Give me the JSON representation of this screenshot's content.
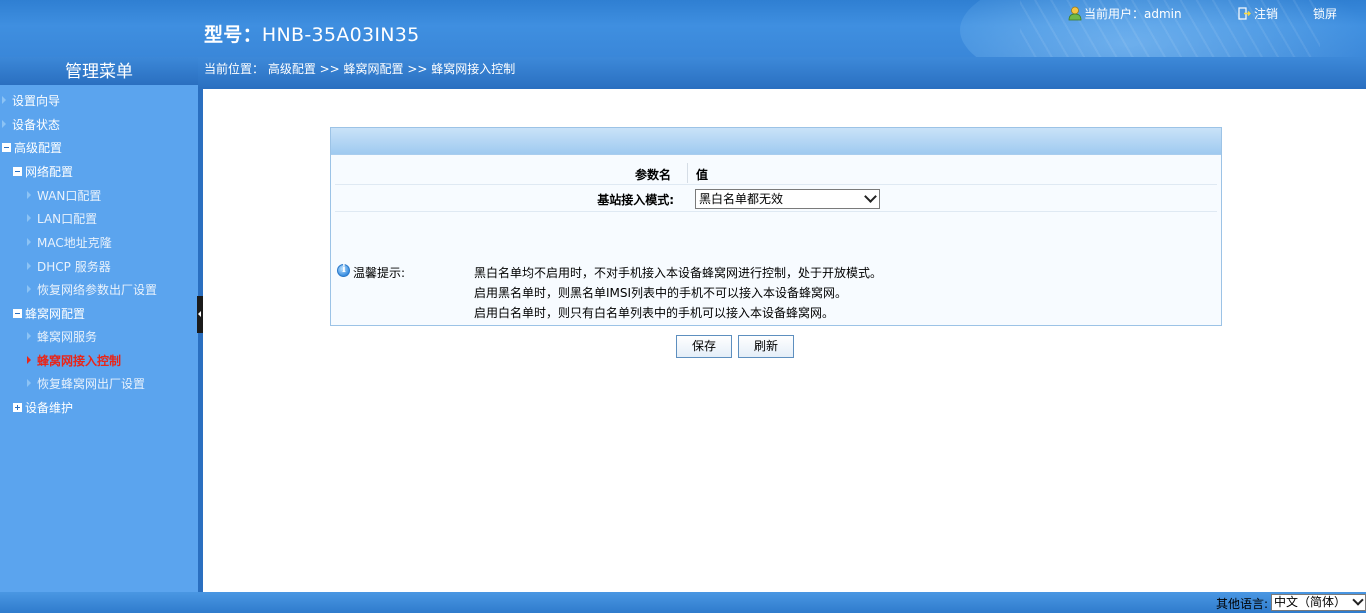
{
  "header": {
    "model_prefix": "型号：",
    "model_value": "HNB-35A03IN35",
    "current_user_label": "当前用户：admin",
    "logout_label": "注销",
    "lock_label": "锁屏"
  },
  "sidebar": {
    "title": "管理菜单",
    "items": [
      {
        "label": "设置向导"
      },
      {
        "label": "设备状态"
      },
      {
        "label": "高级配置"
      },
      {
        "label": "网络配置"
      },
      {
        "label": "WAN口配置"
      },
      {
        "label": "LAN口配置"
      },
      {
        "label": "MAC地址克隆"
      },
      {
        "label": "DHCP 服务器"
      },
      {
        "label": "恢复网络参数出厂设置"
      },
      {
        "label": "蜂窝网配置"
      },
      {
        "label": "蜂窝网服务"
      },
      {
        "label": "蜂窝网接入控制"
      },
      {
        "label": "恢复蜂窝网出厂设置"
      },
      {
        "label": "设备维护"
      }
    ],
    "active_item": "蜂窝网接入控制"
  },
  "breadcrumb": {
    "text": "当前位置： 高级配置 >> 蜂窝网配置 >> 蜂窝网接入控制"
  },
  "form": {
    "col_name": "参数名",
    "col_value": "值",
    "mode_label": "基站接入模式:",
    "mode_value": "黑白名单都无效",
    "tip_label": "温馨提示:",
    "tips": [
      "黑白名单均不启用时，不对手机接入本设备蜂窝网进行控制，处于开放模式。",
      "启用黑名单时，则黑名单IMSI列表中的手机不可以接入本设备蜂窝网。",
      "启用白名单时，则只有白名单列表中的手机可以接入本设备蜂窝网。"
    ]
  },
  "buttons": {
    "save": "保存",
    "refresh": "刷新"
  },
  "footer": {
    "lang_label": "其他语言:",
    "lang_value": "中文（简体）"
  },
  "colors": {
    "header_blue": "#3a87d9",
    "sidebar_blue": "#5ba4ee",
    "active_red": "#e8261a"
  }
}
